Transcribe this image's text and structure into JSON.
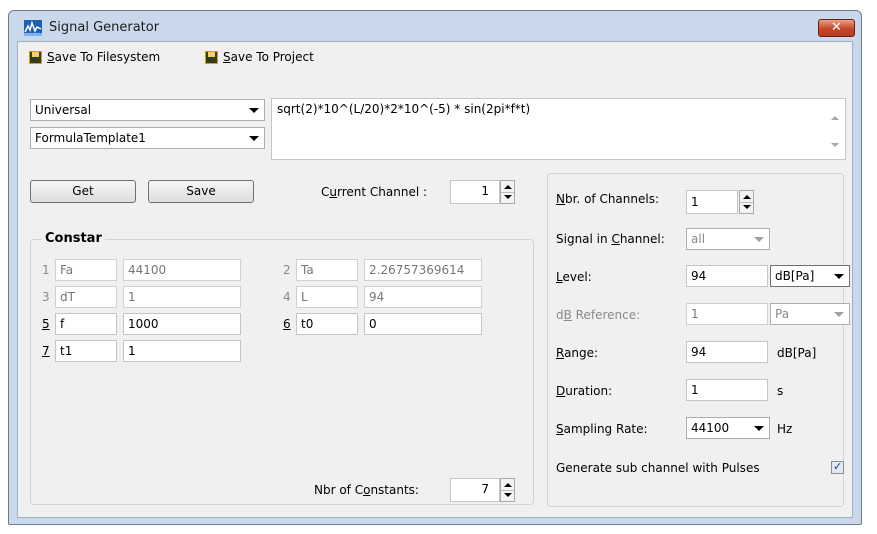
{
  "window": {
    "title": "Signal Generator",
    "close_glyph": "✕"
  },
  "toolbar": {
    "save_fs_label_key": "S",
    "save_fs_label_rest": "ave To Filesystem",
    "save_proj_label_key": "S",
    "save_proj_label_rest": "ave To Project"
  },
  "template": {
    "type": "Universal",
    "name": "FormulaTemplate1",
    "formula": "sqrt(2)*10^(L/20)*2*10^(-5) * sin(2pi*f*t)"
  },
  "left": {
    "get_label": "Get",
    "save_label": "Save",
    "current_channel_label_pre": "C",
    "current_channel_label_key": "u",
    "current_channel_label_post": "rrent Channel :",
    "current_channel": "1",
    "constants_title": "Constar",
    "constants": [
      {
        "idx": "1",
        "name": "Fa",
        "value": "44100",
        "editable": false
      },
      {
        "idx": "2",
        "name": "Ta",
        "value": "2.26757369614",
        "editable": false
      },
      {
        "idx": "3",
        "name": "dT",
        "value": "1",
        "editable": false
      },
      {
        "idx": "4",
        "name": "L",
        "value": "94",
        "editable": false
      },
      {
        "idx": "5",
        "name": "f",
        "value": "1000",
        "editable": true
      },
      {
        "idx": "6",
        "name": "t0",
        "value": "0",
        "editable": true
      },
      {
        "idx": "7",
        "name": "t1",
        "value": "1",
        "editable": true
      }
    ],
    "nbr_constants_label_pre": "Nbr of C",
    "nbr_constants_label_key": "o",
    "nbr_constants_label_post": "nstants:",
    "nbr_constants": "7"
  },
  "right": {
    "channels_label_key": "N",
    "channels_label_rest": "br. of Channels:",
    "channels": "1",
    "signal_in_channel_pre": "Signal in ",
    "signal_in_channel_key": "C",
    "signal_in_channel_post": "hannel:",
    "signal_in_channel": "all",
    "level_label_key": "L",
    "level_label_rest": "evel:",
    "level": "94",
    "level_unit": "dB[Pa]",
    "db_ref_pre": "d",
    "db_ref_key": "B",
    "db_ref_post": " Reference:",
    "db_ref": "1",
    "db_ref_unit": "Pa",
    "range_label_key": "R",
    "range_label_rest": "ange:",
    "range": "94",
    "range_unit": "dB[Pa]",
    "duration_label_key": "D",
    "duration_label_rest": "uration:",
    "duration": "1",
    "duration_unit": "s",
    "sampling_label_key": "S",
    "sampling_label_rest": "ampling Rate:",
    "sampling_rate": "44100",
    "sampling_unit": "Hz",
    "pulses_label": "Generate sub channel with Pulses",
    "pulses_checked": true
  }
}
